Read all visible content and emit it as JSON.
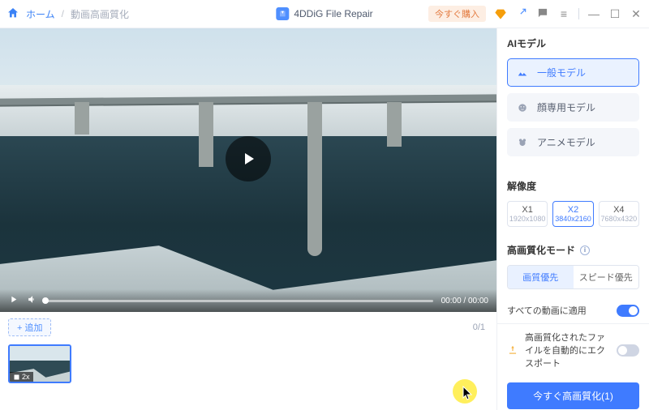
{
  "titlebar": {
    "home_label": "ホーム",
    "separator": "/",
    "current_page": "動画高画質化",
    "app_name": "4DDiG File Repair",
    "buy_now": "今すぐ購入"
  },
  "video": {
    "time_current": "00:00",
    "time_total": "00:00",
    "time_display": "00:00 / 00:00"
  },
  "strip": {
    "add_label": "+ 追加",
    "count": "0/1",
    "thumb_badge": "2x"
  },
  "panel": {
    "ai_model_title": "AIモデル",
    "models": {
      "general": "一般モデル",
      "face": "顔専用モデル",
      "anime": "アニメモデル"
    },
    "resolution_title": "解像度",
    "resolutions": [
      {
        "x": "X1",
        "dim": "1920x1080"
      },
      {
        "x": "X2",
        "dim": "3840x2160"
      },
      {
        "x": "X4",
        "dim": "7680x4320"
      }
    ],
    "mode_title": "高画質化モード",
    "modes": {
      "quality": "画質優先",
      "speed": "スピード優先"
    },
    "apply_all": "すべての動画に適用",
    "auto_export": "高画質化されたファイルを自動的にエクスポート",
    "primary_button": "今すぐ高画質化(1)"
  }
}
